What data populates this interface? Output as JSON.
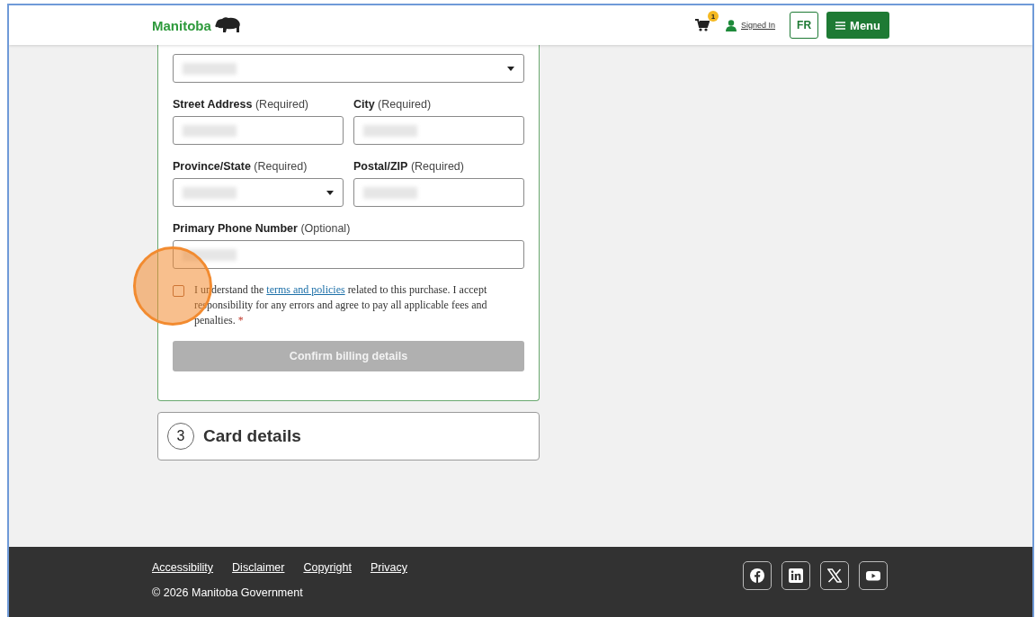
{
  "header": {
    "logo": "Manitoba",
    "cart_count": "1",
    "account": "Signed In",
    "language": "FR",
    "menu": "Menu"
  },
  "billing_form": {
    "rows": [
      [
        {
          "kind": "select"
        }
      ],
      [
        {
          "kind": "text",
          "label": "Street Address",
          "hint": "(Required)"
        },
        {
          "kind": "text",
          "label": "City",
          "hint": "(Required)"
        }
      ],
      [
        {
          "kind": "select",
          "label": "Province/State",
          "hint": "(Required)"
        },
        {
          "kind": "text",
          "label": "Postal/ZIP",
          "hint": "(Required)"
        }
      ],
      [
        {
          "kind": "text",
          "label": "Primary Phone Number",
          "hint": "(Optional)"
        }
      ]
    ],
    "consent": {
      "checked": false,
      "highlight": true,
      "before": "I understand the ",
      "link": "terms and policies",
      "after": " related to this purchase. I accept responsibility for any errors and agree to pay all applicable fees and penalties.",
      "required_mark": "*"
    },
    "submit": {
      "label": "Confirm billing details",
      "disabled": true
    }
  },
  "next_step": {
    "number": "3",
    "title": "Card details"
  },
  "footer": {
    "links": [
      "Accessibility",
      "Disclaimer",
      "Copyright",
      "Privacy"
    ],
    "copyright": "© 2026 Manitoba Government",
    "social": [
      {
        "kind": "facebook"
      },
      {
        "kind": "linkedin"
      },
      {
        "kind": "x"
      },
      {
        "kind": "youtube"
      }
    ]
  }
}
